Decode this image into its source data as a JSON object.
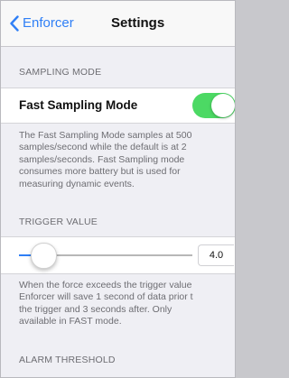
{
  "nav": {
    "back_label": "Enforcer",
    "title": "Settings"
  },
  "sampling": {
    "header": "SAMPLING MODE",
    "toggle_label": "Fast Sampling Mode",
    "toggle_on": true,
    "footer": "The Fast Sampling Mode samples at 500\nsamples/second while the default is at 2\nsamples/seconds. Fast Sampling mode\nconsumes more battery but is used for\nmeasuring dynamic events."
  },
  "trigger": {
    "header": "TRIGGER VALUE",
    "slider_fraction": 0.14,
    "value": "4.0",
    "footer": "When the force exceeds the trigger value\nEnforcer will save 1 second of data prior t\nthe trigger and 3 seconds after. Only\navailable in FAST mode."
  },
  "alarm": {
    "header": "ALARM THRESHOLD"
  },
  "colors": {
    "accent": "#2f7ff6",
    "toggle_on": "#4cd964",
    "background": "#efeff4",
    "secondary_text": "#6d6d72"
  }
}
